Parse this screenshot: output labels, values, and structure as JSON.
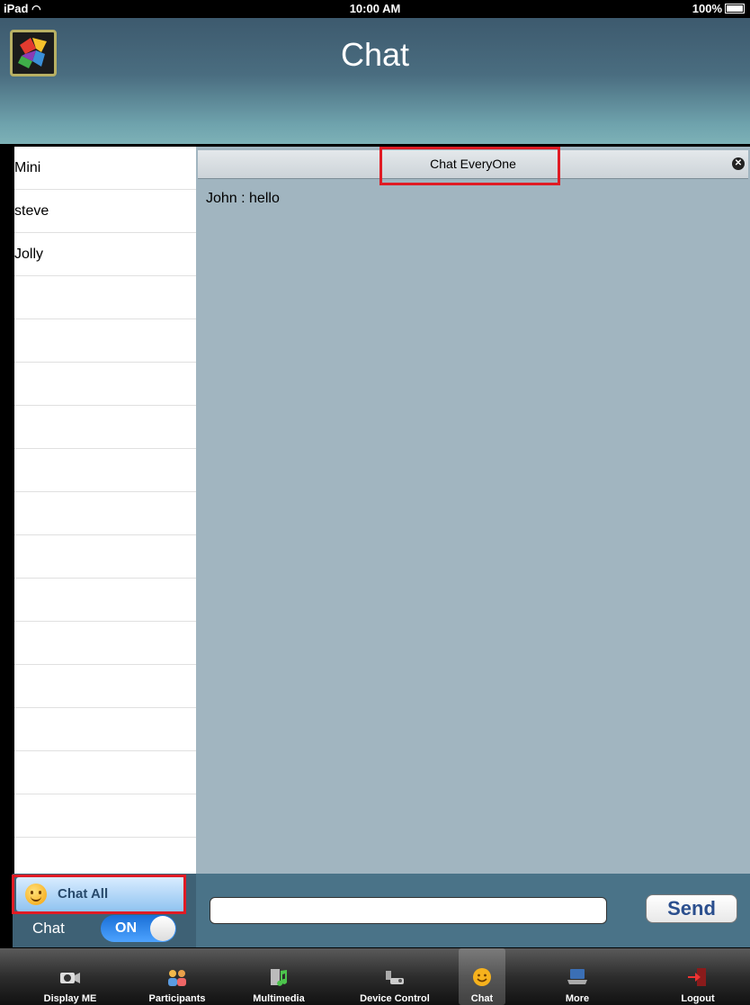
{
  "status_bar": {
    "device": "iPad",
    "time": "10:00 AM",
    "battery": "100%"
  },
  "nav": {
    "title": "Chat"
  },
  "participants": [
    "Mini",
    "steve",
    "Jolly",
    "",
    "",
    "",
    "",
    "",
    "",
    "",
    "",
    "",
    "",
    "",
    "",
    "",
    ""
  ],
  "sidebar_footer": {
    "chat_all_label": "Chat All",
    "chat_toggle_label": "Chat",
    "chat_toggle_state": "ON"
  },
  "chat": {
    "header_title": "Chat EveryOne",
    "messages": [
      "John : hello"
    ]
  },
  "compose": {
    "input_value": "",
    "send_label": "Send"
  },
  "tab_bar": {
    "tabs": [
      {
        "label": "Display ME",
        "icon": "camera-icon"
      },
      {
        "label": "Participants",
        "icon": "participants-icon"
      },
      {
        "label": "Multimedia",
        "icon": "multimedia-icon"
      },
      {
        "label": "Device Control",
        "icon": "device-control-icon"
      },
      {
        "label": "Chat",
        "icon": "chat-smiley-icon"
      },
      {
        "label": "More",
        "icon": "more-laptop-icon"
      },
      {
        "label": "Logout",
        "icon": "logout-door-icon"
      }
    ],
    "selected": "Chat"
  },
  "colors": {
    "highlight_box": "#e01b24",
    "compose_bar": "#4a7388",
    "chat_area": "#a1b5c0",
    "send_text": "#2b4f8e"
  }
}
